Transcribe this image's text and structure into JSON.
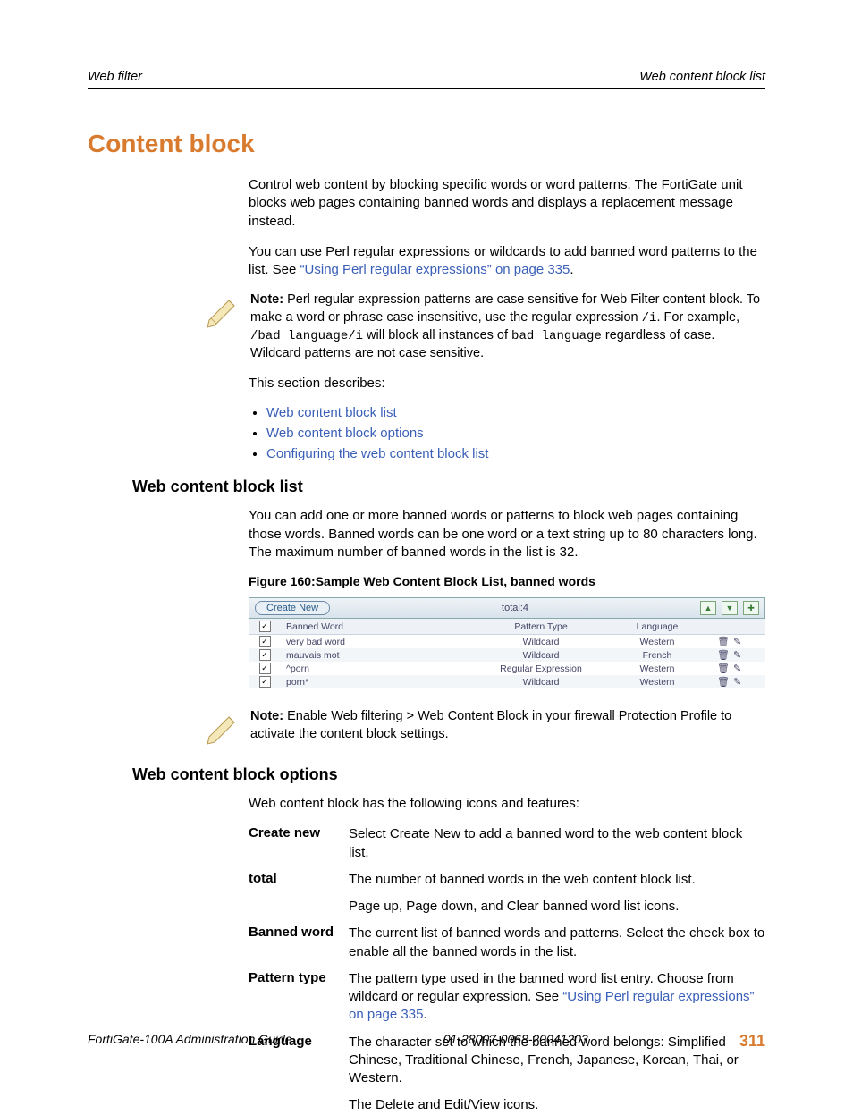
{
  "header": {
    "left": "Web filter",
    "right": "Web content block list"
  },
  "title": "Content block",
  "intro1": "Control web content by blocking specific words or word patterns. The FortiGate unit blocks web pages containing banned words and displays a replacement message instead.",
  "intro2_a": "You can use Perl regular expressions or wildcards to add banned word patterns to the list. See ",
  "intro2_link": "“Using Perl regular expressions” on page 335",
  "intro2_b": ".",
  "note1": {
    "prefix": "Note:",
    "t1": " Perl regular expression patterns are case sensitive for Web Filter content block. To make a word or phrase case insensitive, use the regular expression ",
    "code1": "/i",
    "t2": ". For example, ",
    "code2": "/bad language/i",
    "t3": " will block all instances of ",
    "code3": "bad language",
    "t4": " regardless of case. Wildcard patterns are not case sensitive."
  },
  "describes": "This section describes:",
  "bullets": [
    "Web content block list",
    "Web content block options",
    "Configuring the web content block list"
  ],
  "sect1": {
    "title": "Web content block list",
    "p": "You can add one or more banned words or patterns to block web pages containing those words. Banned words can be one word or a text string up to 80 characters long. The maximum number of banned words in the list is 32.",
    "caption": "Figure 160:Sample Web Content Block List, banned words"
  },
  "screenshot": {
    "create": "Create New",
    "total": "total:4",
    "cols": {
      "c1": "Banned Word",
      "c2": "Pattern Type",
      "c3": "Language"
    },
    "rows": [
      {
        "word": "very bad word",
        "type": "Wildcard",
        "lang": "Western"
      },
      {
        "word": "mauvais mot",
        "type": "Wildcard",
        "lang": "French"
      },
      {
        "word": "^porn",
        "type": "Regular Expression",
        "lang": "Western"
      },
      {
        "word": "porn*",
        "type": "Wildcard",
        "lang": "Western"
      }
    ]
  },
  "note2": {
    "prefix": "Note:",
    "text": " Enable Web filtering > Web Content Block in your firewall Protection Profile to activate the content block settings."
  },
  "sect2": {
    "title": "Web content block options",
    "p": "Web content block has the following icons and features:"
  },
  "opts": {
    "create_new": {
      "term": "Create new",
      "desc": "Select Create New to add a banned word to the web content block list."
    },
    "total": {
      "term": "total",
      "desc": "The number of banned words in the web content block list."
    },
    "icons1": {
      "desc": "Page up, Page down, and Clear banned word list icons."
    },
    "banned": {
      "term": "Banned word",
      "desc": "The current list of banned words and patterns. Select the check box to enable all the banned words in the list."
    },
    "pattern": {
      "term": "Pattern type",
      "desc_a": "The pattern type used in the banned word list entry. Choose from wildcard or regular expression. See ",
      "link": "“Using Perl regular expressions” on page 335",
      "desc_b": "."
    },
    "lang": {
      "term": "Language",
      "desc": "The character set to which the banned word belongs: Simplified Chinese, Traditional Chinese, French, Japanese, Korean, Thai, or Western."
    },
    "icons2": {
      "desc": "The Delete and Edit/View icons."
    }
  },
  "footer": {
    "left": "FortiGate-100A Administration Guide",
    "center": "01-28007-0068-20041203",
    "page": "311"
  }
}
